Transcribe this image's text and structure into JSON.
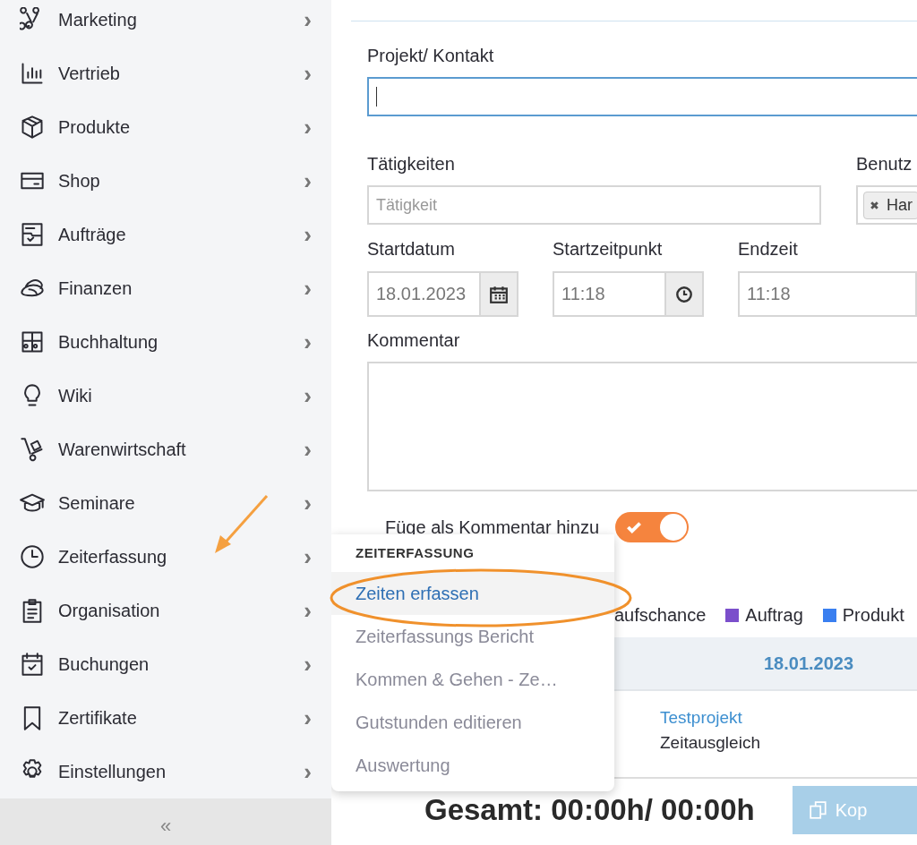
{
  "sidebar": {
    "items": [
      {
        "label": "Marketing",
        "chevron": "›"
      },
      {
        "label": "Vertrieb",
        "chevron": "›"
      },
      {
        "label": "Produkte",
        "chevron": "›"
      },
      {
        "label": "Shop",
        "chevron": "›"
      },
      {
        "label": "Aufträge",
        "chevron": "›"
      },
      {
        "label": "Finanzen",
        "chevron": "›"
      },
      {
        "label": "Buchhaltung",
        "chevron": "›"
      },
      {
        "label": "Wiki",
        "chevron": "›"
      },
      {
        "label": "Warenwirtschaft",
        "chevron": "›"
      },
      {
        "label": "Seminare",
        "chevron": "›"
      },
      {
        "label": "Zeiterfassung",
        "chevron": "›"
      },
      {
        "label": "Organisation",
        "chevron": "›"
      },
      {
        "label": "Buchungen",
        "chevron": "›"
      },
      {
        "label": "Zertifikate",
        "chevron": "›"
      },
      {
        "label": "Einstellungen",
        "chevron": "›"
      }
    ],
    "collapse": "«"
  },
  "form": {
    "project": {
      "label": "Projekt/ Kontakt"
    },
    "activities": {
      "label": "Tätigkeiten",
      "placeholder": "Tätigkeit"
    },
    "users": {
      "label": "Benutz",
      "chip": "Har"
    },
    "start_date": {
      "label": "Startdatum",
      "value": "18.01.2023"
    },
    "start_time": {
      "label": "Startzeitpunkt",
      "value": "11:18"
    },
    "end_time": {
      "label": "Endzeit",
      "value": "11:18"
    },
    "comment": {
      "label": "Kommentar"
    },
    "add_as_comment": {
      "label": "Füge als Kommentar hinzu",
      "on": true
    }
  },
  "legend": [
    {
      "label": "aufschance"
    },
    {
      "label": "Auftrag",
      "color": "#7b4fcb"
    },
    {
      "label": "Produkt",
      "color": "#3a7ff0"
    }
  ],
  "table": {
    "day_header": "18.01.2023",
    "row": {
      "project": "Testprojekt",
      "activity": "Zeitausgleich"
    }
  },
  "total": "Gesamt: 00:00h/ 00:00h",
  "copy_button": "Kop",
  "popup": {
    "title": "ZEITERFASSUNG",
    "items": [
      {
        "label": "Zeiten erfassen",
        "selected": true
      },
      {
        "label": "Zeiterfassungs Bericht",
        "selected": false
      },
      {
        "label": "Kommen & Gehen - Ze…",
        "selected": false
      },
      {
        "label": "Gutstunden editieren",
        "selected": false
      },
      {
        "label": "Auswertung",
        "selected": false
      }
    ]
  }
}
